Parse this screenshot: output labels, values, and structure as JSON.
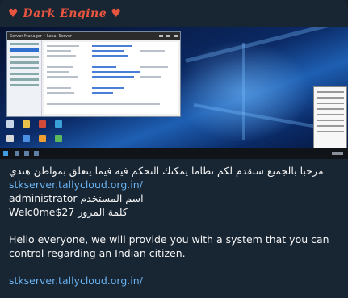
{
  "message": {
    "sender_name": "♥ Dark Engine ♥",
    "window_title": "Server Manager • Local Server",
    "arabic_intro": "مرحبا بالجميع سنقدم لكم نظاما يمكنك التحكم فيه فيما يتعلق بمواطن هندي",
    "link_1": "stkserver.tallycloud.org.in/",
    "username_line": "اسم المستخدم administrator",
    "password_line": "كلمة المرور Welc0me$27",
    "english_body": "Hello everyone, we will provide you with a system that you can control regarding an Indian citizen.",
    "link_2": "stkserver.tallycloud.org.in/"
  },
  "colors": {
    "sender": "#e8553f",
    "link": "#6ab3f3",
    "text": "#f5f5f5",
    "bubble": "#182533"
  }
}
